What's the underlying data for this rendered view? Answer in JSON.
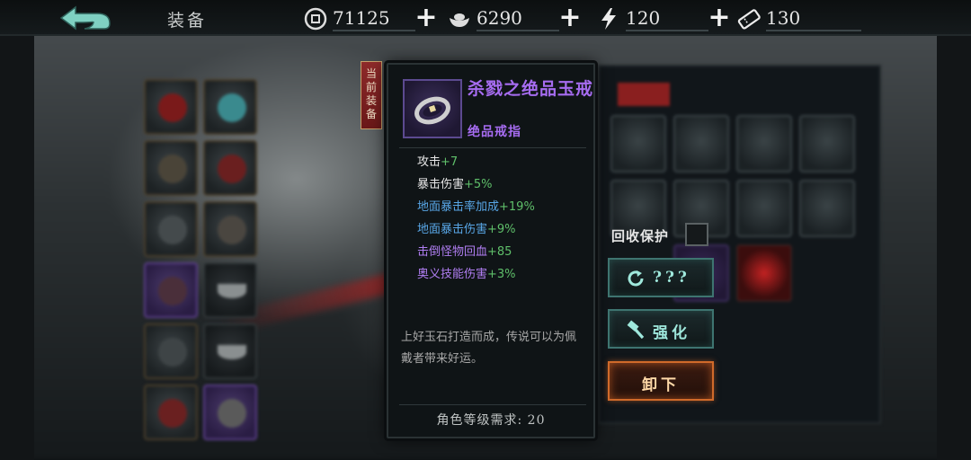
{
  "header": {
    "title": "装备",
    "back_icon": "back-arrow-icon"
  },
  "resources": [
    {
      "icon": "coin-icon",
      "value": "71125"
    },
    {
      "icon": "ingot-icon",
      "value": "6290"
    },
    {
      "icon": "stamina-bolt-icon",
      "value": "120"
    },
    {
      "icon": "ticket-icon",
      "value": "130"
    }
  ],
  "equipped_tag": "当前装备",
  "item": {
    "name": "杀戮之绝品玉戒",
    "type": "绝品戒指",
    "icon": "jade-ring-icon",
    "stats": [
      {
        "name": "攻击",
        "bonus": "+7",
        "color": "#e8e8e8"
      },
      {
        "name": "暴击伤害",
        "bonus": "+5%",
        "color": "#e8e8e8"
      },
      {
        "name": "地面暴击率加成",
        "bonus": "+19%",
        "color": "#58a6e6"
      },
      {
        "name": "地面暴击伤害",
        "bonus": "+9%",
        "color": "#58a6e6"
      },
      {
        "name": "击倒怪物回血",
        "bonus": "+85",
        "color": "#b07ef2"
      },
      {
        "name": "奥义技能伤害",
        "bonus": "+3%",
        "color": "#b07ef2"
      }
    ],
    "description": "上好玉石打造而成，传说可以为佩戴者带来好运。",
    "requirement": "角色等级需求: 20"
  },
  "recycle_protect": {
    "label": "回收保护",
    "checked": false
  },
  "buttons": {
    "mystery": "???",
    "enhance": "强化",
    "unequip": "卸下"
  },
  "colors": {
    "rarity_purple": "#a66cf0",
    "bonus_green": "#5fbf6a",
    "button_teal": "#3e7470",
    "unequip_orange": "#d06a2a"
  }
}
